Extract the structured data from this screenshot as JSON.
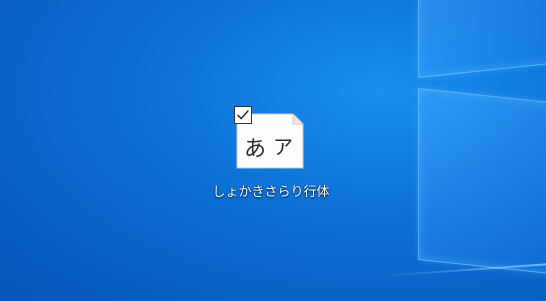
{
  "desktop": {
    "background_color": "#0b6fd6",
    "icons": [
      {
        "label": "しょかきさらり行体",
        "icon": "font-file-icon",
        "selected": true,
        "preview_glyphs": [
          "あ",
          "ア"
        ]
      }
    ]
  }
}
